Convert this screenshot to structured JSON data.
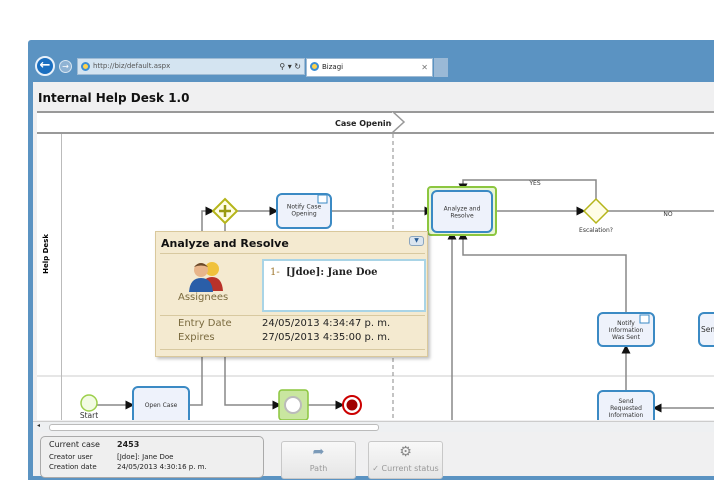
{
  "browser": {
    "url": "http://biz/default.aspx",
    "tab_title": "Bizagi"
  },
  "app": {
    "title": "Internal Help Desk 1.0"
  },
  "phase": {
    "label": "Case Opening"
  },
  "lane": {
    "label": "Help Desk"
  },
  "diagram": {
    "tasks": {
      "notify_case_opening": "Notify Case Opening",
      "analyze_resolve": "Analyze and Resolve",
      "notify_info_sent": "Notify Information Was Sent",
      "send_requested": "Send Requested Information",
      "open_case": "Open Case",
      "partial_right": "Sen"
    },
    "gateway_label": "Escalation?",
    "yes": "YES",
    "no": "NO",
    "start_label": "Start"
  },
  "popup": {
    "title": "Analyze and Resolve",
    "assignees_label": "Assignees",
    "assignee_num": "1-",
    "assignee": "[Jdoe]: Jane Doe",
    "entry_date_label": "Entry Date",
    "entry_date": "24/05/2013 4:34:47 p. m.",
    "expires_label": "Expires",
    "expires": "27/05/2013 4:35:00 p. m."
  },
  "case_info": {
    "current_case_label": "Current case",
    "current_case": "2453",
    "creator_label": "Creator user",
    "creator": "[Jdoe]: Jane Doe",
    "creation_label": "Creation date",
    "creation": "24/05/2013 4:30:16 p. m."
  },
  "buttons": {
    "path": "Path",
    "current_status": "Current status"
  },
  "colors": {
    "frame": "#5b93c2",
    "task_border": "#3b8ac4",
    "highlight": "#8cc63f",
    "gateway": "#c8c81e",
    "popup_bg": "#f4ead0",
    "end_event": "#a00000"
  }
}
